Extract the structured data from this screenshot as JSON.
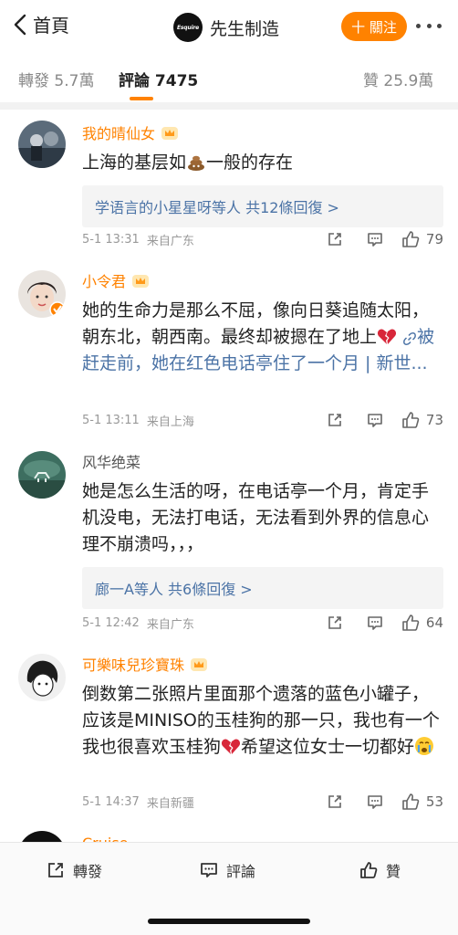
{
  "nav": {
    "back_label": "首頁",
    "account_logo_text": "Esquire",
    "account_name": "先生制造",
    "follow_label": "十 關注"
  },
  "tabs": {
    "repost": "轉發 5.7萬",
    "comments": "評論 7475",
    "likes": "贊 25.9萬"
  },
  "comments": [
    {
      "username": "我的晴仙女",
      "text_parts": [
        "上海的基层如",
        "一般的存在"
      ],
      "replies": "学语言的小星星呀等人 共12條回復 >",
      "time": "5-1 13:31",
      "location": "来自广东",
      "likes": "79"
    },
    {
      "username": "小令君",
      "text_main": "她的生命力是那么不屈，像向日葵追随太阳，朝东北，朝西南。最终却被摁在了地上",
      "text_link": "被赶走前，她在红色电话亭住了一个月 | 新世...",
      "time": "5-1 13:11",
      "location": "来自上海",
      "likes": "73"
    },
    {
      "username": "风华绝菜",
      "text": "她是怎么生活的呀，在电话亭一个月，肯定手机没电，无法打电话，无法看到外界的信息心理不崩溃吗，，，",
      "replies": "廊一A等人 共6條回復 >",
      "time": "5-1 12:42",
      "location": "来自广东",
      "likes": "64"
    },
    {
      "username": "可樂味兒珍寶珠",
      "text_parts": [
        "倒数第二张照片里面那个遗落的蓝色小罐子，应该是MINISO的玉桂狗的那一只，我也有一个我也很喜欢玉桂狗",
        "希望这位女士一切都好"
      ],
      "time": "5-1 14:37",
      "location": "来自新疆",
      "likes": "53"
    },
    {
      "username": "Cruise"
    }
  ],
  "bottom_bar": {
    "repost": "轉發",
    "comment": "評論",
    "like": "贊"
  },
  "colors": {
    "accent": "#ff8200",
    "link": "#4b73a6",
    "meta": "#999999"
  }
}
